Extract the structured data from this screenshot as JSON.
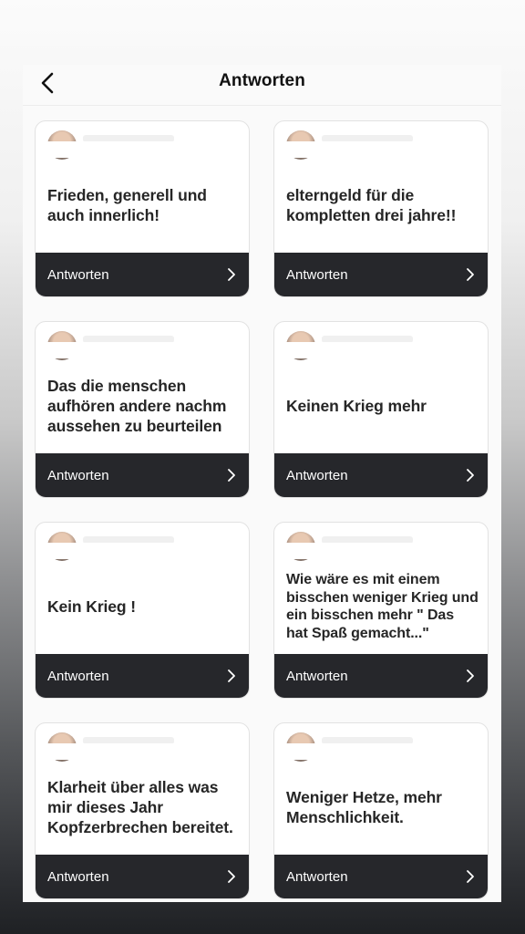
{
  "header": {
    "title": "Antworten",
    "back_icon": "chevron-left-icon"
  },
  "cards": [
    {
      "text": "Frieden, generell und auch innerlich!",
      "reply_label": "Antworten"
    },
    {
      "text": "elterngeld für die kompletten drei jahre!!",
      "reply_label": "Antworten"
    },
    {
      "text": "Das die menschen aufhören andere nachm aussehen zu beurteilen",
      "reply_label": "Antworten"
    },
    {
      "text": "Keinen Krieg mehr",
      "reply_label": "Antworten"
    },
    {
      "text": "Kein Krieg !",
      "reply_label": "Antworten"
    },
    {
      "text": "Wie wäre es mit einem bisschen weniger Krieg und ein bisschen mehr \" Das hat Spaß gemacht...\"",
      "reply_label": "Antworten"
    },
    {
      "text": "Klarheit über alles was mir dieses Jahr Kopfzerbrechen bereitet.",
      "reply_label": "Antworten"
    },
    {
      "text": "Weniger Hetze, mehr Menschlichkeit.",
      "reply_label": "Antworten"
    }
  ],
  "colors": {
    "card_footer": "#26272b",
    "panel_background": "#fafafa"
  }
}
